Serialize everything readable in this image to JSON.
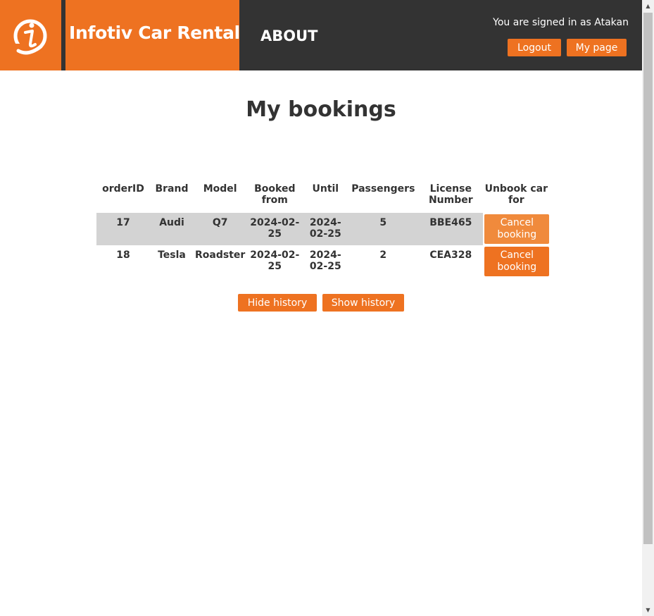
{
  "header": {
    "brand_title": "Infotiv Car Rental",
    "about_label": "ABOUT",
    "signed_in_text": "You are signed in as Atakan",
    "logout_label": "Logout",
    "mypage_label": "My page",
    "accent_color": "#ee7221",
    "dark_color": "#333333"
  },
  "main": {
    "title": "My bookings",
    "columns": [
      "orderID",
      "Brand",
      "Model",
      "Booked from",
      "Until",
      "Passengers",
      "License Number",
      "Unbook car for"
    ],
    "rows": [
      {
        "orderID": "17",
        "brand": "Audi",
        "model": "Q7",
        "booked_from": "2024-02-25",
        "until": "2024-02-25",
        "passengers": "5",
        "license": "BBE465",
        "action": "Cancel booking"
      },
      {
        "orderID": "18",
        "brand": "Tesla",
        "model": "Roadster",
        "booked_from": "2024-02-25",
        "until": "2024-02-25",
        "passengers": "2",
        "license": "CEA328",
        "action": "Cancel booking"
      }
    ],
    "hide_history_label": "Hide history",
    "show_history_label": "Show history"
  },
  "icons": {
    "logo": "infotiv-logo-icon",
    "scroll_up": "scroll-up-icon",
    "scroll_down": "scroll-down-icon"
  }
}
